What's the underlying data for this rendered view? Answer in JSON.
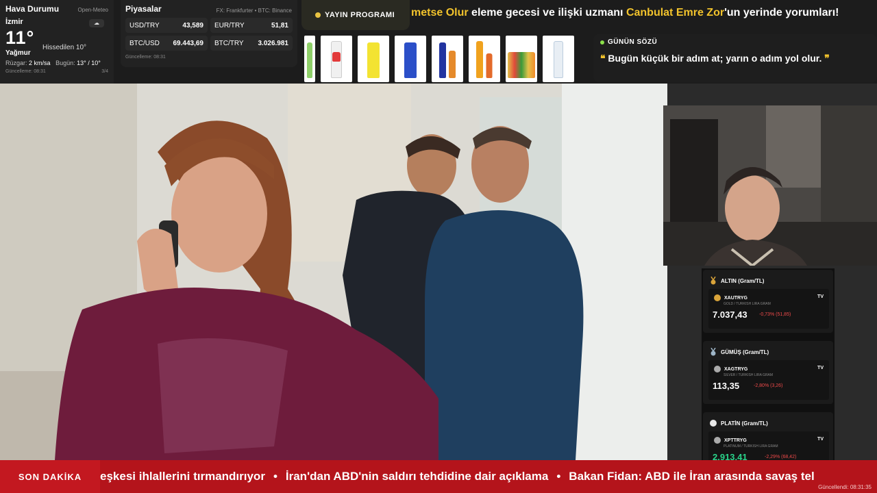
{
  "weather": {
    "title": "Hava Durumu",
    "source": "Open-Meteo",
    "city": "İzmir",
    "temp": "11°",
    "feels": "Hissedilen 10°",
    "condition": "Yağmur",
    "wind_label": "Rüzgar:",
    "wind_value": "2 km/sa",
    "today_label": "Bugün:",
    "today_value": "13° / 10°",
    "updated": "Güncelleme: 08:31",
    "page": "3/4"
  },
  "markets": {
    "title": "Piyasalar",
    "source": "FX: Frankfurter • BTC: Binance",
    "rows": [
      {
        "label": "USD/TRY",
        "value": "43,589"
      },
      {
        "label": "EUR/TRY",
        "value": "51,81"
      },
      {
        "label": "BTC/USD",
        "value": "69.443,69"
      },
      {
        "label": "BTC/TRY",
        "value": "3.026.981"
      }
    ],
    "updated": "Güncelleme: 08:31"
  },
  "program": {
    "label": "YAYIN PROGRAMI"
  },
  "top_ticker": {
    "part1": "metse Olur",
    "part2": " eleme gecesi ve ilişki uzmanı ",
    "part3": "Canbulat Emre Zor",
    "part4": "'un yerinde yorumları!"
  },
  "quote": {
    "label": "GÜNÜN SÖZÜ",
    "open": "❝",
    "text": " Bugün küçük bir adım at; yarın o adım yol olur. ",
    "close": "❞"
  },
  "cards": [
    {
      "head": "ALTIN (Gram/TL)",
      "symbol": "XAUTRYG",
      "sub": "GOLD / TURKISH LIRA GRAM",
      "price": "7.037,43",
      "change": "-0,73% (51,85)",
      "medal": "#d9a43a",
      "price_color": "#ffffff"
    },
    {
      "head": "GÜMÜŞ (Gram/TL)",
      "symbol": "XAGTRYG",
      "sub": "SILVER / TURKISH LIRA GRAM",
      "price": "113,35",
      "change": "-2,80% (3,26)",
      "medal": "#9fb6c8",
      "price_color": "#ffffff"
    },
    {
      "head": "PLATİN (Gram/TL)",
      "symbol": "XPTTRYG",
      "sub": "PLATINUM / TURKISH LIRA GRAM",
      "price": "2.913,41",
      "change": "-2,29% (68,42)",
      "medal": "#e8e8e8",
      "price_color": "#2ad38a"
    }
  ],
  "tv_badge": "TV",
  "bottom": {
    "label": "SON DAKİKA",
    "items": [
      "eşkesi ihlallerini tırmandırıyor",
      "İran'dan ABD'nin saldırı tehdidine dair açıklama",
      "Bakan Fidan: ABD ile İran arasında savaş tel"
    ],
    "separator": "•",
    "updated": "Güncellendi: 08:31:35"
  },
  "colors": {
    "accent": "#f2c32c",
    "breaking": "#b4141b",
    "up": "#2ad38a",
    "down": "#f04a4a"
  }
}
